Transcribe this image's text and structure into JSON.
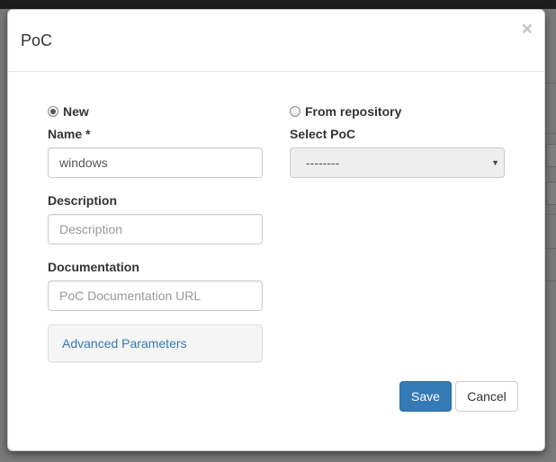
{
  "modal": {
    "title": "PoC",
    "close_label": "×"
  },
  "options": {
    "new_label": "New",
    "new_checked": true,
    "repo_label": "From repository",
    "repo_checked": false
  },
  "name_field": {
    "label": "Name *",
    "value": "windows"
  },
  "select_poc": {
    "label": "Select PoC",
    "selected": "--------",
    "disabled": true
  },
  "description_field": {
    "label": "Description",
    "placeholder": "Description",
    "value": ""
  },
  "documentation_field": {
    "label": "Documentation",
    "placeholder": "PoC Documentation URL",
    "value": ""
  },
  "advanced": {
    "link_label": "Advanced Parameters"
  },
  "footer": {
    "save_label": "Save",
    "cancel_label": "Cancel"
  },
  "colors": {
    "primary": "#337ab7",
    "link": "#337ab7",
    "backdrop": "#7a7a7a"
  }
}
